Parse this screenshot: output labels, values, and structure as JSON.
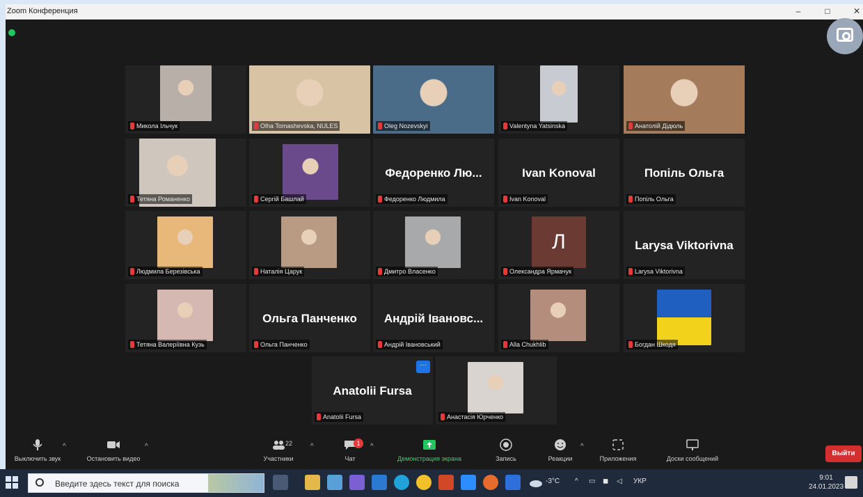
{
  "window": {
    "title": "Zoom Конференция",
    "minimize": "–",
    "maximize": "□",
    "close": "✕"
  },
  "tiles": [
    {
      "key": "t1",
      "label": "Микола Ільчук",
      "type": "photo",
      "photoColor": "#b8b0a8"
    },
    {
      "key": "t2",
      "label": "Olha Tomashevska, NULES",
      "type": "photo",
      "photoColor": "#d8c3a5"
    },
    {
      "key": "t3",
      "label": "Oleg Nozevskyi",
      "type": "photo",
      "photoColor": "#4b6c88"
    },
    {
      "key": "t4",
      "label": "Valentyna Yatsinska",
      "type": "photo",
      "photoColor": "#c8ccd2"
    },
    {
      "key": "t5",
      "label": "Анатолій Дідюль",
      "type": "photo",
      "photoColor": "#a57c5b",
      "active": true
    },
    {
      "key": "t6",
      "label": "Тетяна Романенко",
      "type": "photo",
      "photoColor": "#cfc7bd"
    },
    {
      "key": "t7",
      "label": "Сергій Башлай",
      "type": "photo",
      "photoColor": "#6a4a8a"
    },
    {
      "key": "t8",
      "label": "Федоренко Людмила",
      "type": "name",
      "bigName": "Федоренко Лю..."
    },
    {
      "key": "t9",
      "label": "Ivan Konoval",
      "type": "name",
      "bigName": "Ivan Konoval"
    },
    {
      "key": "t10",
      "label": "Попіль Ольга",
      "type": "name",
      "bigName": "Попіль Ольга"
    },
    {
      "key": "t11",
      "label": "Людмила Березівська",
      "type": "photo",
      "photoColor": "#e7b87a"
    },
    {
      "key": "t12",
      "label": "Наталія Царук",
      "type": "photo",
      "photoColor": "#b99b84"
    },
    {
      "key": "t13",
      "label": "Дмитро Власенко",
      "type": "photo",
      "photoColor": "#a7a9ab"
    },
    {
      "key": "t14",
      "label": "Олександра Ярмачук",
      "type": "initial",
      "initial": "Л"
    },
    {
      "key": "t15",
      "label": "Larysa Viktorivna",
      "type": "name",
      "bigName": "Larysa Viktorivna"
    },
    {
      "key": "t16",
      "label": "Тетяна Валеріївна Кузь",
      "type": "photo",
      "photoColor": "#d6b8b3"
    },
    {
      "key": "t17",
      "label": "Ольга Панченко",
      "type": "name",
      "bigName": "Ольга Панченко"
    },
    {
      "key": "t18",
      "label": "Андрій Івановський",
      "type": "name",
      "bigName": "Андрій Івановс..."
    },
    {
      "key": "t19",
      "label": "Alla Chukhlib",
      "type": "photo",
      "photoColor": "#b58d7c"
    },
    {
      "key": "t20",
      "label": "Богдан Шкодя",
      "type": "flag"
    },
    {
      "key": "t21",
      "label": "Anatolii Fursa",
      "type": "name",
      "bigName": "Anatolii Fursa",
      "more": "···"
    },
    {
      "key": "t22",
      "label": "Анастасія Юрченко",
      "type": "photo",
      "photoColor": "#d9d4cf"
    }
  ],
  "toolbar": {
    "mute": "Выключить звук",
    "video": "Остановить видео",
    "participants": "Участники",
    "participants_count": "22",
    "chat": "Чат",
    "chat_badge": "1",
    "share": "Демонстрация экрана",
    "record": "Запись",
    "reactions": "Реакции",
    "apps": "Приложения",
    "whiteboard": "Доски сообщений",
    "leave": "Выйти"
  },
  "taskbar": {
    "search_placeholder": "Введите здесь текст для поиска",
    "weather": "-3°C",
    "lang": "УКР",
    "time": "9:01",
    "date": "24.01.2023"
  },
  "colors": {
    "active_speaker": "#c9e04a",
    "leave_button": "#d32f2f",
    "share_icon": "#22c55e"
  }
}
